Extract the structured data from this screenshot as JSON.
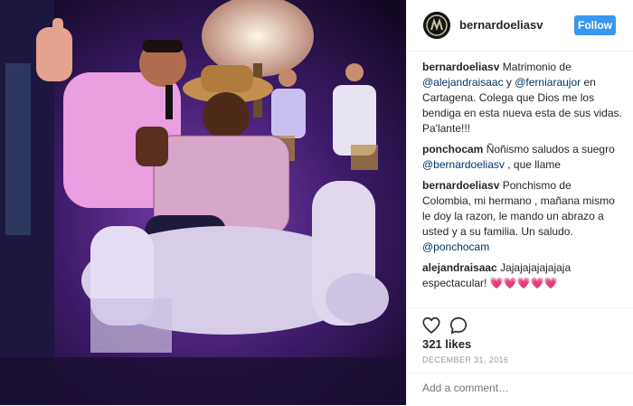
{
  "post": {
    "username": "bernardoeliasv",
    "follow_label": "Follow",
    "comments": [
      {
        "user": "bernardoeliasv",
        "parts": [
          {
            "t": "Matrimonio de "
          },
          {
            "t": "@alejandraisaac",
            "m": true
          },
          {
            "t": " y "
          },
          {
            "t": "@ferniaraujor",
            "m": true
          },
          {
            "t": " en Cartagena. Colega que Dios me los bendiga en esta nueva esta de sus vidas. Pa'lante!!!"
          }
        ]
      },
      {
        "user": "ponchocam",
        "parts": [
          {
            "t": "Ñoñismo saludos a suegro "
          },
          {
            "t": "@bernardoeliasv",
            "m": true
          },
          {
            "t": " , que llame"
          }
        ]
      },
      {
        "user": "bernardoeliasv",
        "parts": [
          {
            "t": "Ponchismo de Colombia, mi hermano , mañana mismo le doy la razon, le mando un abrazo a usted y a su familia. Un saludo. "
          },
          {
            "t": "@ponchocam",
            "m": true
          }
        ]
      },
      {
        "user": "alejandraisaac",
        "parts": [
          {
            "t": "Jajajajajajajaja espectacular! "
          },
          {
            "t": "💗💗💗💗💗",
            "h": true
          }
        ]
      }
    ],
    "likes": "321 likes",
    "date": "DECEMBER 31, 2016",
    "add_comment_placeholder": "Add a comment…",
    "icons": {
      "like": "heart-outline-icon",
      "comment": "speech-bubble-icon"
    },
    "colors": {
      "follow_button": "#3897f0",
      "mention": "#003569",
      "hearts": "#ed4bd6",
      "muted": "#999999"
    }
  }
}
